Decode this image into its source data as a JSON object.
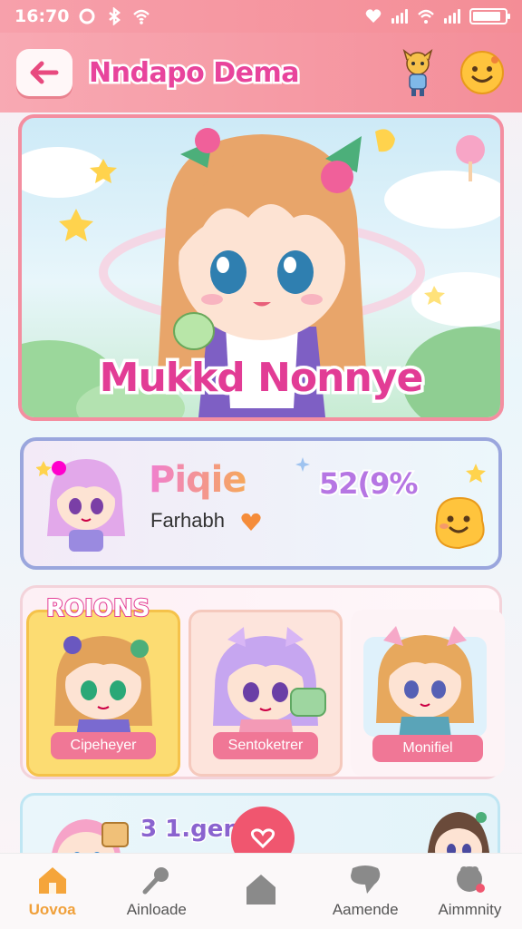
{
  "status_bar": {
    "time": "16:70"
  },
  "header": {
    "title": "Nndapo Dema"
  },
  "hero": {
    "title": "Mukkd Nonnye"
  },
  "profile": {
    "name": "Piqie",
    "subtitle": "Farhabh",
    "score": "52(9%"
  },
  "characters": {
    "section_label": "ROIONS",
    "items": [
      {
        "label": "Cipeheyer"
      },
      {
        "label": "Sentoketrer"
      },
      {
        "label": "Monifiel"
      }
    ]
  },
  "promo": {
    "text": "3 1.gen"
  },
  "bottom_nav": [
    {
      "label": "Uovoa"
    },
    {
      "label": "Ainloade"
    },
    {
      "label": ""
    },
    {
      "label": "Aamende"
    },
    {
      "label": "Aimmnity"
    }
  ],
  "colors": {
    "header": "#f48e99",
    "accent_pink": "#e8449c",
    "nav_active": "#f0a03a"
  }
}
